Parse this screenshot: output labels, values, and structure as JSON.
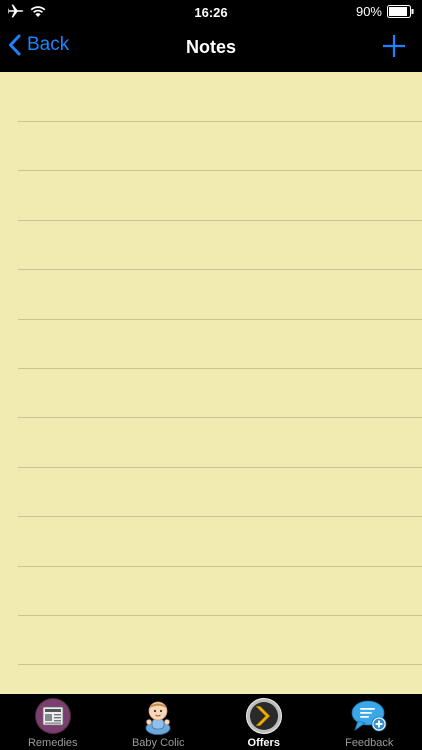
{
  "status_bar": {
    "time": "16:26",
    "battery": "90%",
    "icons": [
      "airplane-icon",
      "wifi-icon",
      "battery-icon"
    ]
  },
  "nav": {
    "back_label": "Back",
    "title": "Notes",
    "add_icon": "plus-icon",
    "accent_color": "#1a84ff"
  },
  "notepad": {
    "background_color": "#f1ebb1",
    "line_color": "#c9c39a"
  },
  "tabs": [
    {
      "label": "Remedies",
      "icon": "newspaper-icon",
      "active": false
    },
    {
      "label": "Baby Colic",
      "icon": "baby-icon",
      "active": false
    },
    {
      "label": "Offers",
      "icon": "chevron-right-icon",
      "active": true
    },
    {
      "label": "Feedback",
      "icon": "speech-bubble-plus-icon",
      "active": false
    }
  ]
}
